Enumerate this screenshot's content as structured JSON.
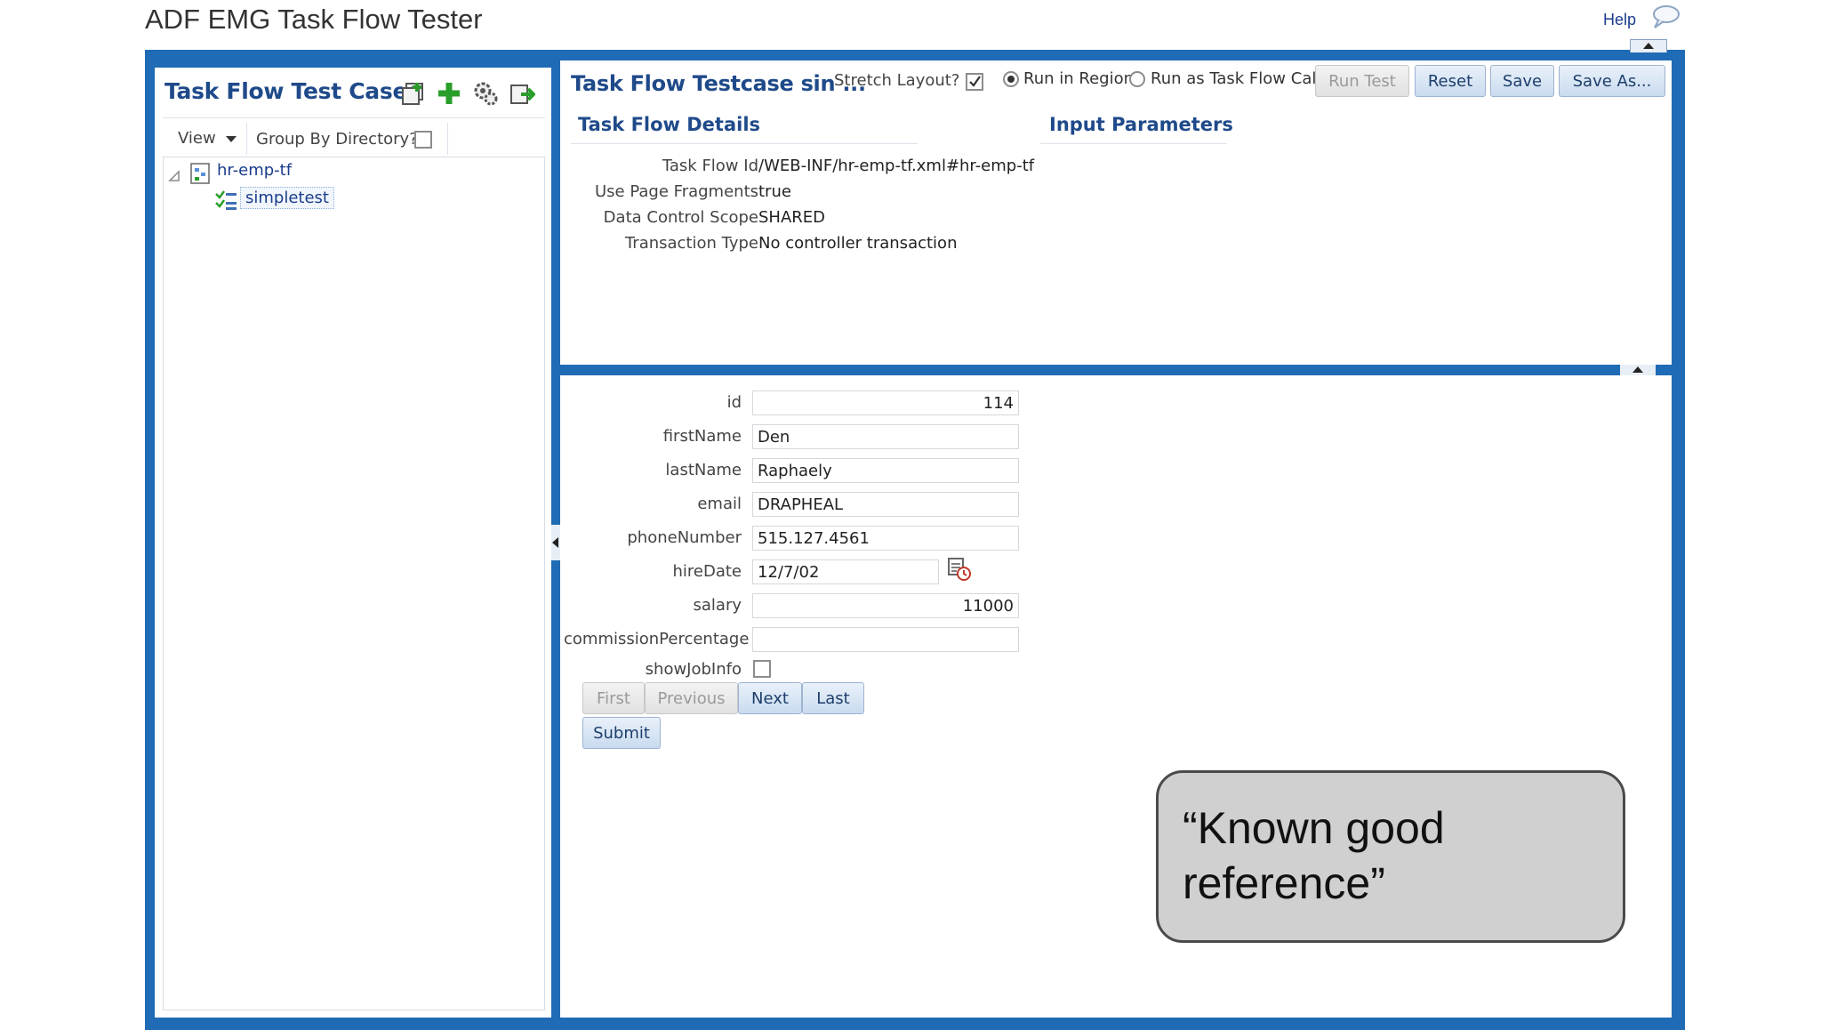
{
  "app": {
    "title": "ADF EMG Task Flow Tester",
    "help": "Help"
  },
  "left_panel": {
    "title": "Task Flow Test Cases",
    "toolbar": {
      "view_label": "View",
      "group_by_label": "Group By Directory?",
      "group_by_checked": false
    },
    "tree": [
      {
        "label": "hr-emp-tf",
        "children": [
          {
            "label": "simpletest"
          }
        ]
      }
    ]
  },
  "testcase": {
    "title": "Task Flow Testcase sin ...",
    "stretch_label": "Stretch Layout?",
    "stretch_checked": true,
    "run_in_region_label": "Run in Region",
    "run_as_call_label": "Run as Task Flow Call",
    "buttons": {
      "run_test": "Run Test",
      "reset": "Reset",
      "save": "Save",
      "save_as": "Save As..."
    },
    "details_title": "Task Flow Details",
    "input_params_title": "Input Parameters",
    "details": [
      {
        "label": "Task Flow Id",
        "value": "/WEB-INF/hr-emp-tf.xml#hr-emp-tf"
      },
      {
        "label": "Use Page Fragments",
        "value": "true"
      },
      {
        "label": "Data Control Scope",
        "value": "SHARED"
      },
      {
        "label": "Transaction Type",
        "value": "No controller transaction"
      }
    ]
  },
  "form": {
    "id_label": "id",
    "id_value": "114",
    "firstName_label": "firstName",
    "firstName_value": "Den",
    "lastName_label": "lastName",
    "lastName_value": "Raphaely",
    "email_label": "email",
    "email_value": "DRAPHEAL",
    "phone_label": "phoneNumber",
    "phone_value": "515.127.4561",
    "hireDate_label": "hireDate",
    "hireDate_value": "12/7/02",
    "salary_label": "salary",
    "salary_value": "11000",
    "commission_label": "commissionPercentage",
    "commission_value": "",
    "showJobInfo_label": "showJobInfo",
    "nav": {
      "first": "First",
      "previous": "Previous",
      "next": "Next",
      "last": "Last"
    },
    "submit": "Submit"
  },
  "callout": {
    "text": "“Known good reference”"
  }
}
